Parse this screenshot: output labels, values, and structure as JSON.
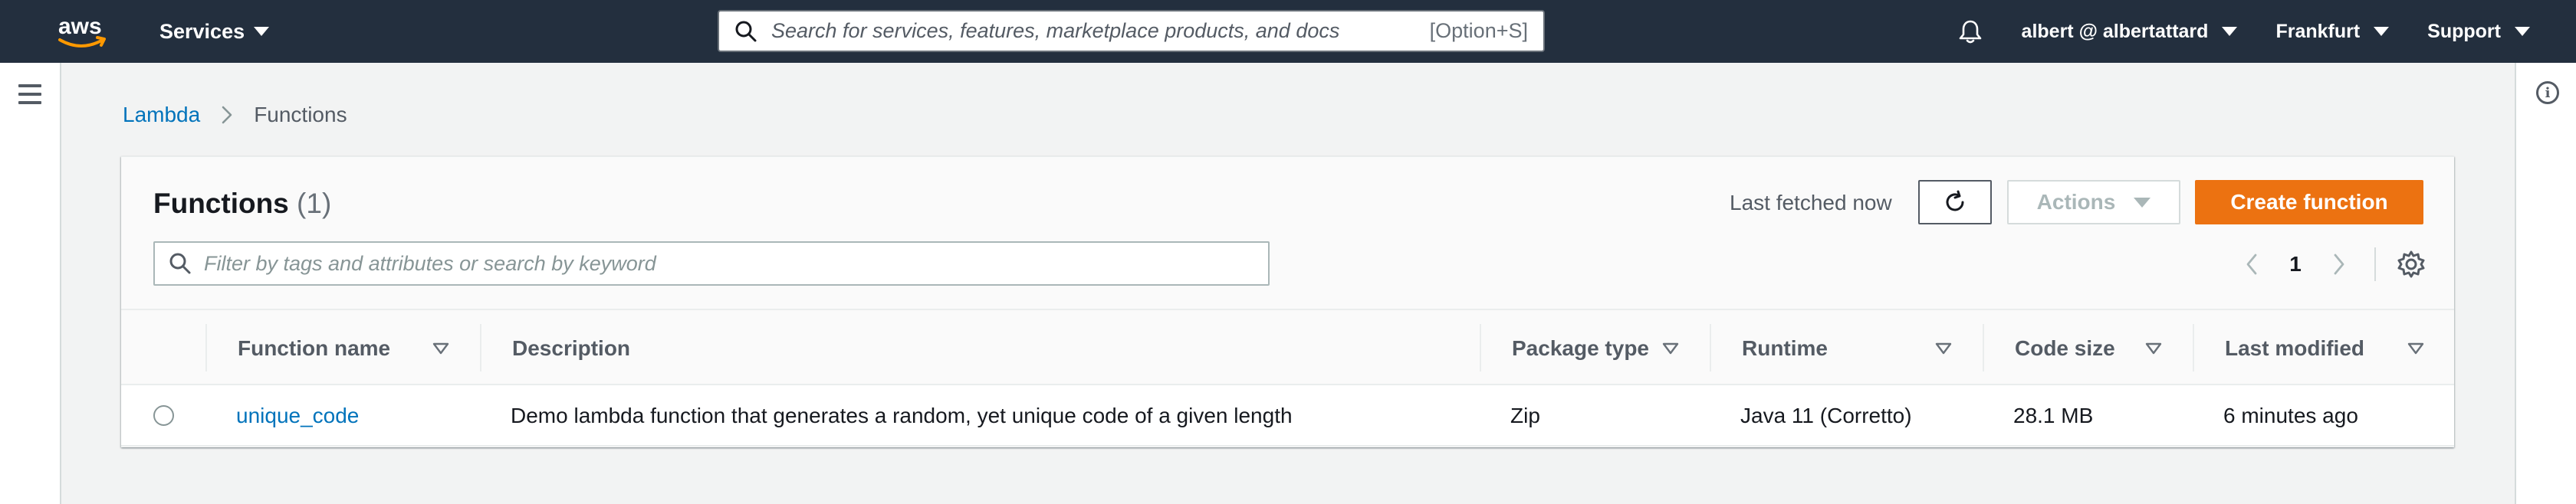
{
  "topnav": {
    "logo_text": "aws",
    "services_label": "Services",
    "search_placeholder": "Search for services, features, marketplace products, and docs",
    "search_shortcut": "[Option+S]",
    "account_label": "albert @ albertattard",
    "region_label": "Frankfurt",
    "support_label": "Support"
  },
  "breadcrumb": {
    "parent": "Lambda",
    "current": "Functions"
  },
  "panel": {
    "title": "Functions",
    "count": "(1)",
    "last_fetched": "Last fetched now",
    "actions_label": "Actions",
    "create_label": "Create function",
    "filter_placeholder": "Filter by tags and attributes or search by keyword",
    "page_number": "1"
  },
  "table": {
    "columns": [
      {
        "label": "Function name",
        "sortable": true
      },
      {
        "label": "Description",
        "sortable": false
      },
      {
        "label": "Package type",
        "sortable": true
      },
      {
        "label": "Runtime",
        "sortable": true
      },
      {
        "label": "Code size",
        "sortable": true
      },
      {
        "label": "Last modified",
        "sortable": true
      }
    ],
    "rows": [
      {
        "function_name": "unique_code",
        "description": "Demo lambda function that generates a random, yet unique code of a given length",
        "package_type": "Zip",
        "runtime": "Java 11 (Corretto)",
        "code_size": "28.1 MB",
        "last_modified": "6 minutes ago"
      }
    ]
  },
  "colors": {
    "nav_bg": "#232f3e",
    "accent_orange": "#ec7211",
    "link_blue": "#0073bb",
    "page_bg": "#f2f3f3"
  }
}
